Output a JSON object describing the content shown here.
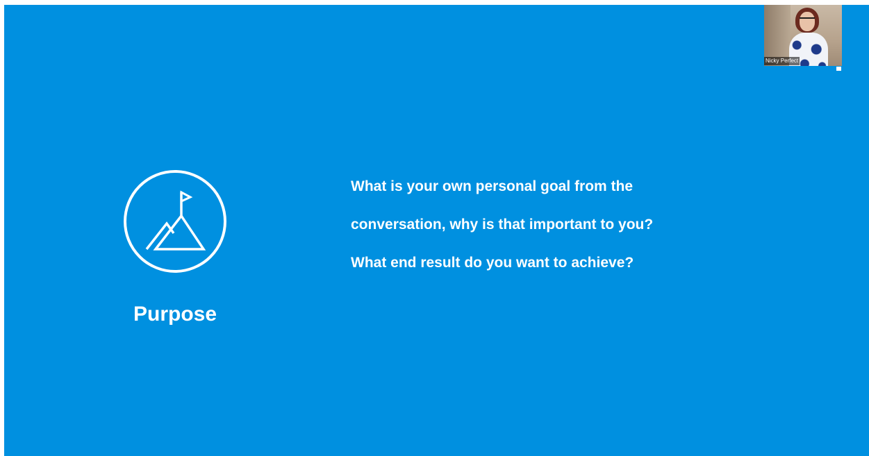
{
  "slide": {
    "background_color": "#0090e0",
    "icon": "mountain-flag-icon",
    "title": "Purpose",
    "questions": [
      "What is your own personal goal from the",
      "conversation, why is that important to you?",
      "What end result do you want to achieve?"
    ]
  },
  "video": {
    "participant_name": "Nicky Perfect"
  }
}
